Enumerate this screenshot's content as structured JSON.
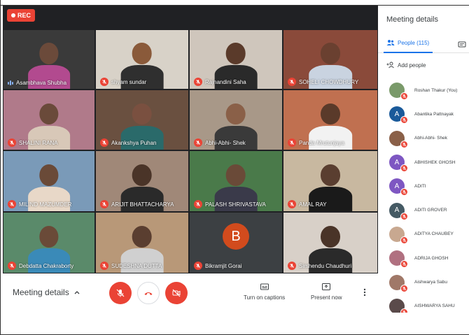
{
  "recording": {
    "label": "REC"
  },
  "tiles": [
    {
      "name": "Asambhava Shubha",
      "muted": false,
      "speaking": true,
      "bg": "#3a3a3a",
      "head": "#6b4a3a",
      "torso": "#b24a8f"
    },
    {
      "name": "shyam sundar",
      "muted": true,
      "bg": "#d8d2c8",
      "head": "#8a5a3a",
      "torso": "#2f2f2f"
    },
    {
      "name": "Rajnandini Saha",
      "muted": true,
      "bg": "#cfc6bc",
      "head": "#5a3a2a",
      "torso": "#2a2a2a"
    },
    {
      "name": "SOHELI CHOWDHURY",
      "muted": true,
      "bg": "#8a4a3a",
      "head": "#6a4030",
      "torso": "#c9d3e0"
    },
    {
      "name": "SHALINI RANA",
      "muted": true,
      "bg": "#b07a8a",
      "head": "#6a4a3a",
      "torso": "#d8c8b8"
    },
    {
      "name": "Akankshya Puhan",
      "muted": true,
      "bg": "#6a5040",
      "head": "#7a5040",
      "torso": "#2a6a6a"
    },
    {
      "name": "Abhi-Abhi- Shek",
      "muted": true,
      "bg": "#a89888",
      "head": "#8a6048",
      "torso": "#3a3a3a"
    },
    {
      "name": "Panda Mrutunjaya",
      "muted": true,
      "bg": "#c07050",
      "head": "#5a3a2a",
      "torso": "#f2f2f2"
    },
    {
      "name": "MILIND MAZUMDER",
      "muted": true,
      "bg": "#7a9ab8",
      "head": "#6a4a38",
      "torso": "#e8d8c8"
    },
    {
      "name": "ARIJIT BHATTACHARYA",
      "muted": true,
      "bg": "#a08878",
      "head": "#4a3428",
      "torso": "#2a2a2a"
    },
    {
      "name": "PALASH SHRIVASTAVA",
      "muted": true,
      "bg": "#4a7a4a",
      "head": "#6a4a38",
      "torso": "#3a3a4a"
    },
    {
      "name": "AMAL RAY",
      "muted": true,
      "bg": "#c8b8a0",
      "head": "#5a3e30",
      "torso": "#1a1a1a"
    },
    {
      "name": "Debdatta Chakraborty",
      "muted": true,
      "bg": "#5a8a6a",
      "head": "#6a4a38",
      "torso": "#3a8ab8"
    },
    {
      "name": "SUDESHNA DUTTA",
      "muted": true,
      "bg": "#b89878",
      "head": "#5a3e30",
      "torso": "#d0d0d0"
    },
    {
      "name": "Bikramjit Gorai",
      "muted": true,
      "avatar": "B",
      "bg": "#3c4043"
    },
    {
      "name": "Sirshendu Chaudhuri",
      "muted": true,
      "bg": "#d8d0c8",
      "head": "#4a3428",
      "torso": "#2a2a2a"
    }
  ],
  "bottom_bar": {
    "meeting_details_label": "Meeting details",
    "captions_label": "Turn on captions",
    "present_label": "Present now"
  },
  "panel": {
    "title": "Meeting details",
    "people_tab": "People (115)",
    "add_people": "Add people",
    "people": [
      {
        "name": "Roshan Thakur (You)",
        "initial": "",
        "color": "#7a9a6a"
      },
      {
        "name": "Abantika Pattnayak",
        "initial": "A",
        "color": "#1a5a9a"
      },
      {
        "name": "Abhi-Abhi- Shek",
        "initial": "",
        "color": "#8a6048"
      },
      {
        "name": "ABHISHEK GHOSH",
        "initial": "A",
        "color": "#7e57c2"
      },
      {
        "name": "ADITI",
        "initial": "A",
        "color": "#7e57c2"
      },
      {
        "name": "ADITI GROVER",
        "initial": "A",
        "color": "#455a64"
      },
      {
        "name": "ADITYA CHAUBEY",
        "initial": "",
        "color": "#c8a890"
      },
      {
        "name": "ADRIJA GHOSH",
        "initial": "",
        "color": "#b07080"
      },
      {
        "name": "Aishwarya Sabu",
        "initial": "",
        "color": "#a07868"
      },
      {
        "name": "AISHWARYA SAHU",
        "initial": "",
        "color": "#5a4a4a"
      }
    ]
  }
}
